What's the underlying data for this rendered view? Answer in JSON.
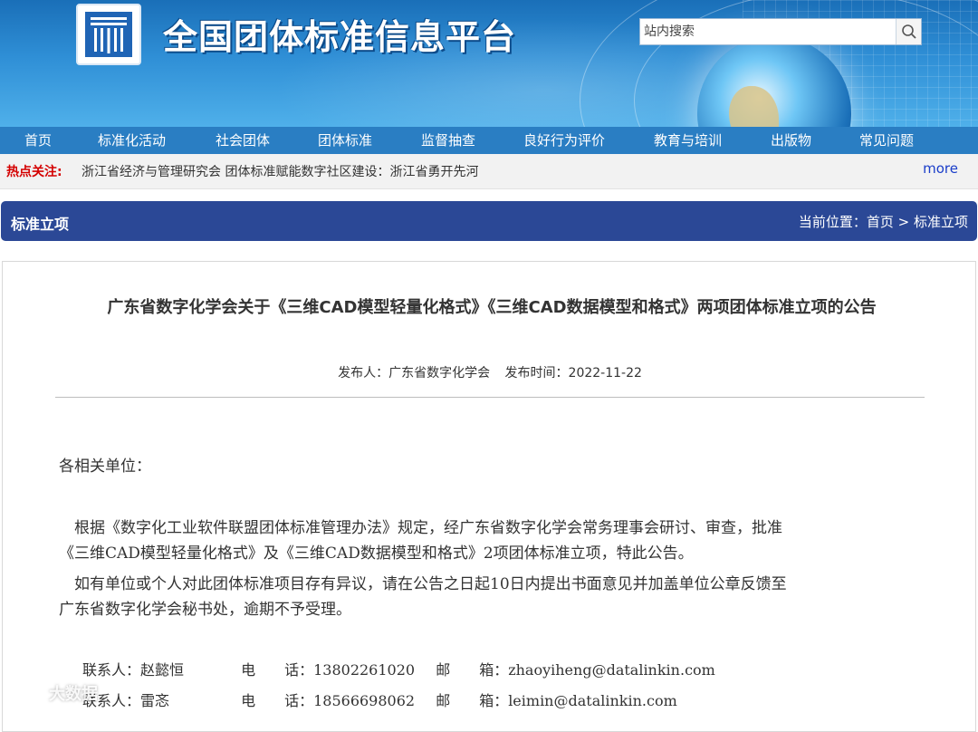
{
  "header": {
    "site_title": "全国团体标准信息平台",
    "search_placeholder": "站内搜索"
  },
  "nav": {
    "items": [
      {
        "label": "首页"
      },
      {
        "label": "标准化活动"
      },
      {
        "label": "社会团体"
      },
      {
        "label": "团体标准"
      },
      {
        "label": "监督抽查"
      },
      {
        "label": "良好行为评价"
      },
      {
        "label": "教育与培训"
      },
      {
        "label": "出版物"
      },
      {
        "label": "常见问题"
      }
    ]
  },
  "hot": {
    "label": "热点关注:",
    "text": "浙江省经济与管理研究会 团体标准赋能数字社区建设：浙江省勇开先河",
    "more": "more"
  },
  "section": {
    "title": "标准立项",
    "breadcrumb": "当前位置：首页 > 标准立项"
  },
  "article": {
    "title": "广东省数字化学会关于《三维CAD模型轻量化格式》《三维CAD数据模型和格式》两项团体标准立项的公告",
    "publisher": "发布人：广东省数字化学会",
    "date": "发布时间：2022-11-22",
    "greeting": "各相关单位：",
    "para1_line1": "　根据《数字化工业软件联盟团体标准管理办法》规定，经广东省数字化学会常务理事会研讨、审查，批准",
    "para1_line2": "《三维CAD模型轻量化格式》及《三维CAD数据模型和格式》2项团体标准立项，特此公告。",
    "para2_line1": "　如有单位或个人对此团体标准项目存有异议，请在公告之日起10日内提出书面意见并加盖单位公章反馈至",
    "para2_line2": "广东省数字化学会秘书处，逾期不予受理。",
    "contacts": [
      {
        "name": "联系人：赵懿恒",
        "phone": "电　　话：13802261020",
        "email": "邮　　箱：zhaoyiheng@datalinkin.com"
      },
      {
        "name": "联系人：雷忞",
        "phone": "电　　话：18566698062",
        "email": "邮　　箱：leimin@datalinkin.com"
      }
    ]
  },
  "watermark": {
    "text": "大数据"
  }
}
